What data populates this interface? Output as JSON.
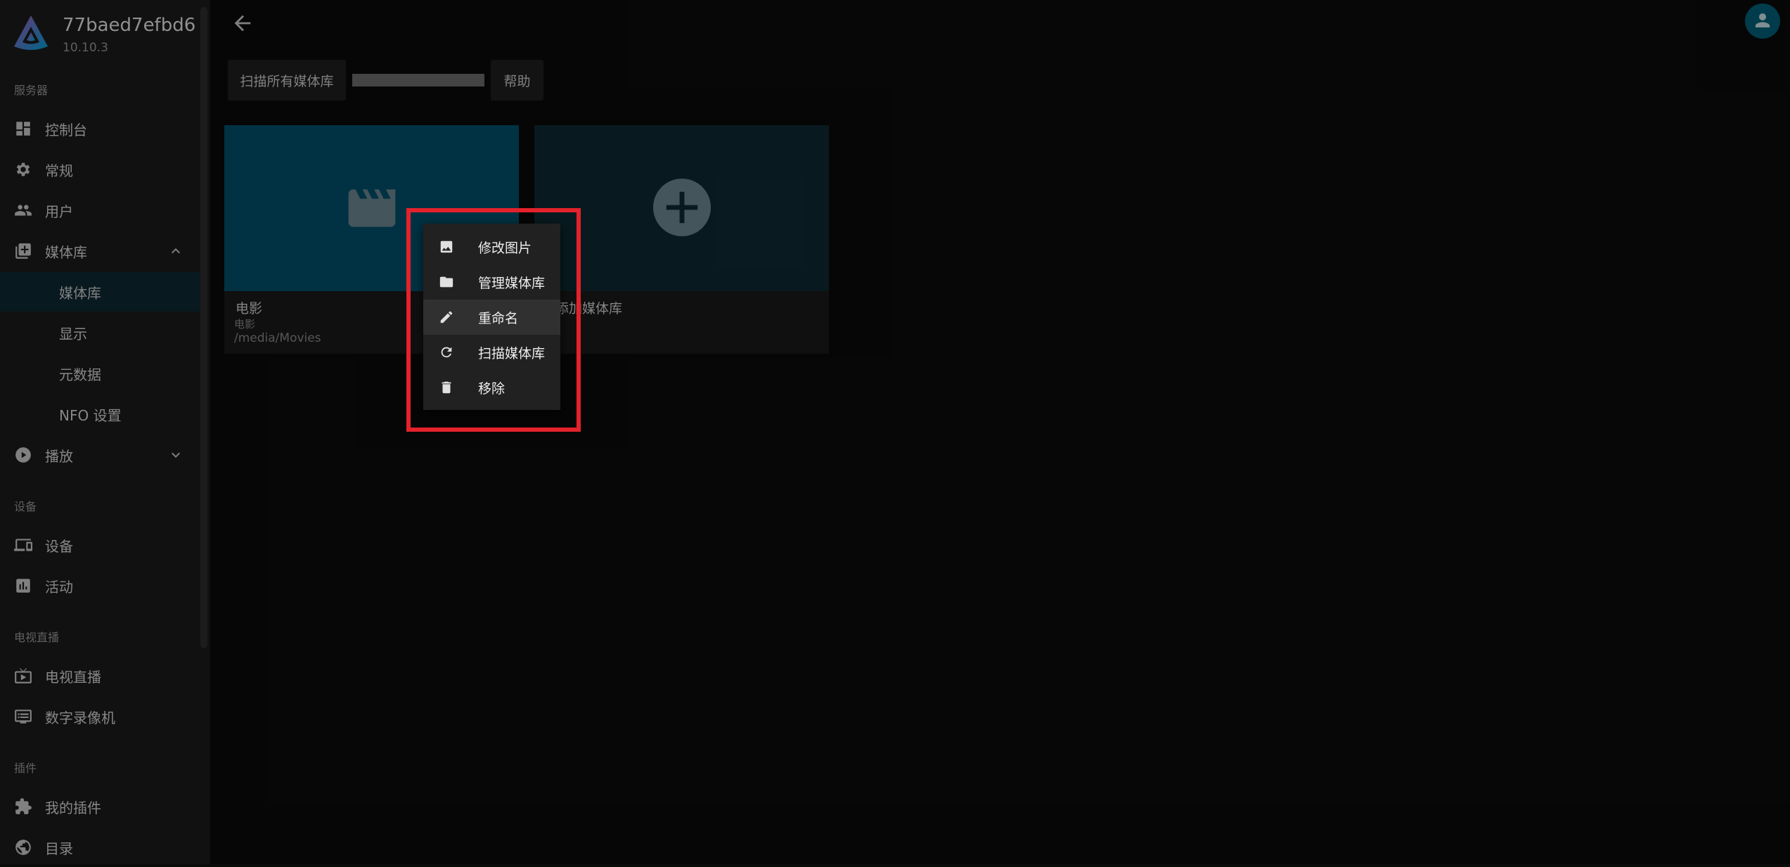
{
  "server": {
    "name": "77baed7efbd6",
    "version": "10.10.3"
  },
  "sidebar": {
    "sections": {
      "server": "服务器",
      "devices": "设备",
      "livetv": "电视直播",
      "plugins": "插件"
    },
    "items": {
      "dashboard": "控制台",
      "general": "常规",
      "users": "用户",
      "libraries": "媒体库",
      "libraries_sub": "媒体库",
      "display": "显示",
      "metadata": "元数据",
      "nfo": "NFO 设置",
      "playback": "播放",
      "devices": "设备",
      "activity": "活动",
      "livetv": "电视直播",
      "dvr": "数字录像机",
      "my_plugins": "我的插件",
      "catalog": "目录"
    }
  },
  "toolbar": {
    "scan_all": "扫描所有媒体库",
    "help": "帮助",
    "scan_progress": 1.0
  },
  "cards": {
    "movies": {
      "title": "电影",
      "type": "电影",
      "path": "/media/Movies"
    },
    "add": {
      "title": "添加媒体库"
    }
  },
  "context_menu": {
    "edit_image": "修改图片",
    "manage": "管理媒体库",
    "rename": "重命名",
    "scan": "扫描媒体库",
    "remove": "移除"
  },
  "colors": {
    "accent": "#00a4dc",
    "highlight_box": "#e3222b",
    "sidebar_active": "#0e2a32"
  }
}
